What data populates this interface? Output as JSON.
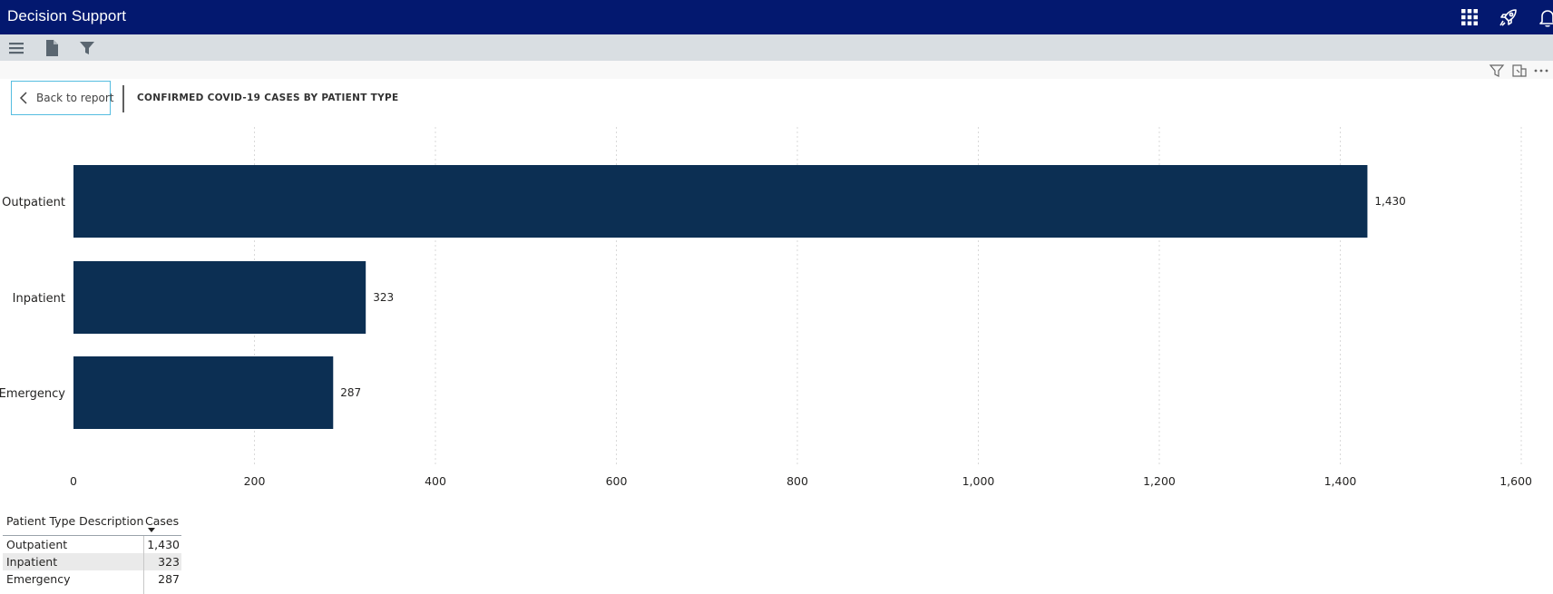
{
  "header": {
    "title": "Decision Support",
    "icons": [
      "apps-grid-icon",
      "rocket-icon",
      "bell-icon"
    ],
    "color": "#03186f"
  },
  "toolbar": {
    "icons": [
      "menu-icon",
      "page-icon",
      "filter-icon"
    ]
  },
  "visual_header": {
    "icons": [
      "filter-icon",
      "focus-icon",
      "more-options-icon"
    ]
  },
  "back": {
    "label": "Back to report"
  },
  "visual": {
    "title": "CONFIRMED COVID-19 CASES BY PATIENT TYPE"
  },
  "chart_data": {
    "type": "bar",
    "orientation": "horizontal",
    "title": "CONFIRMED COVID-19 CASES BY PATIENT TYPE",
    "categories": [
      "Outpatient",
      "Inpatient",
      "Emergency"
    ],
    "values": [
      1430,
      323,
      287
    ],
    "value_labels": [
      "1,430",
      "323",
      "287"
    ],
    "xlim": [
      0,
      1600
    ],
    "x_ticks": [
      0,
      200,
      400,
      600,
      800,
      1000,
      1200,
      1400,
      1600
    ],
    "x_tick_labels": [
      "0",
      "200",
      "400",
      "600",
      "800",
      "1,000",
      "1,200",
      "1,400",
      "1,600"
    ],
    "grid": true,
    "bar_color": "#0c2f53",
    "grid_color": "#d9d9d9"
  },
  "table": {
    "headers": [
      "Patient Type Description",
      "Cases"
    ],
    "rows": [
      [
        "Outpatient",
        "1,430"
      ],
      [
        "Inpatient",
        "323"
      ],
      [
        "Emergency",
        "287"
      ]
    ],
    "sort_column": "Cases",
    "sort_direction": "descending"
  }
}
